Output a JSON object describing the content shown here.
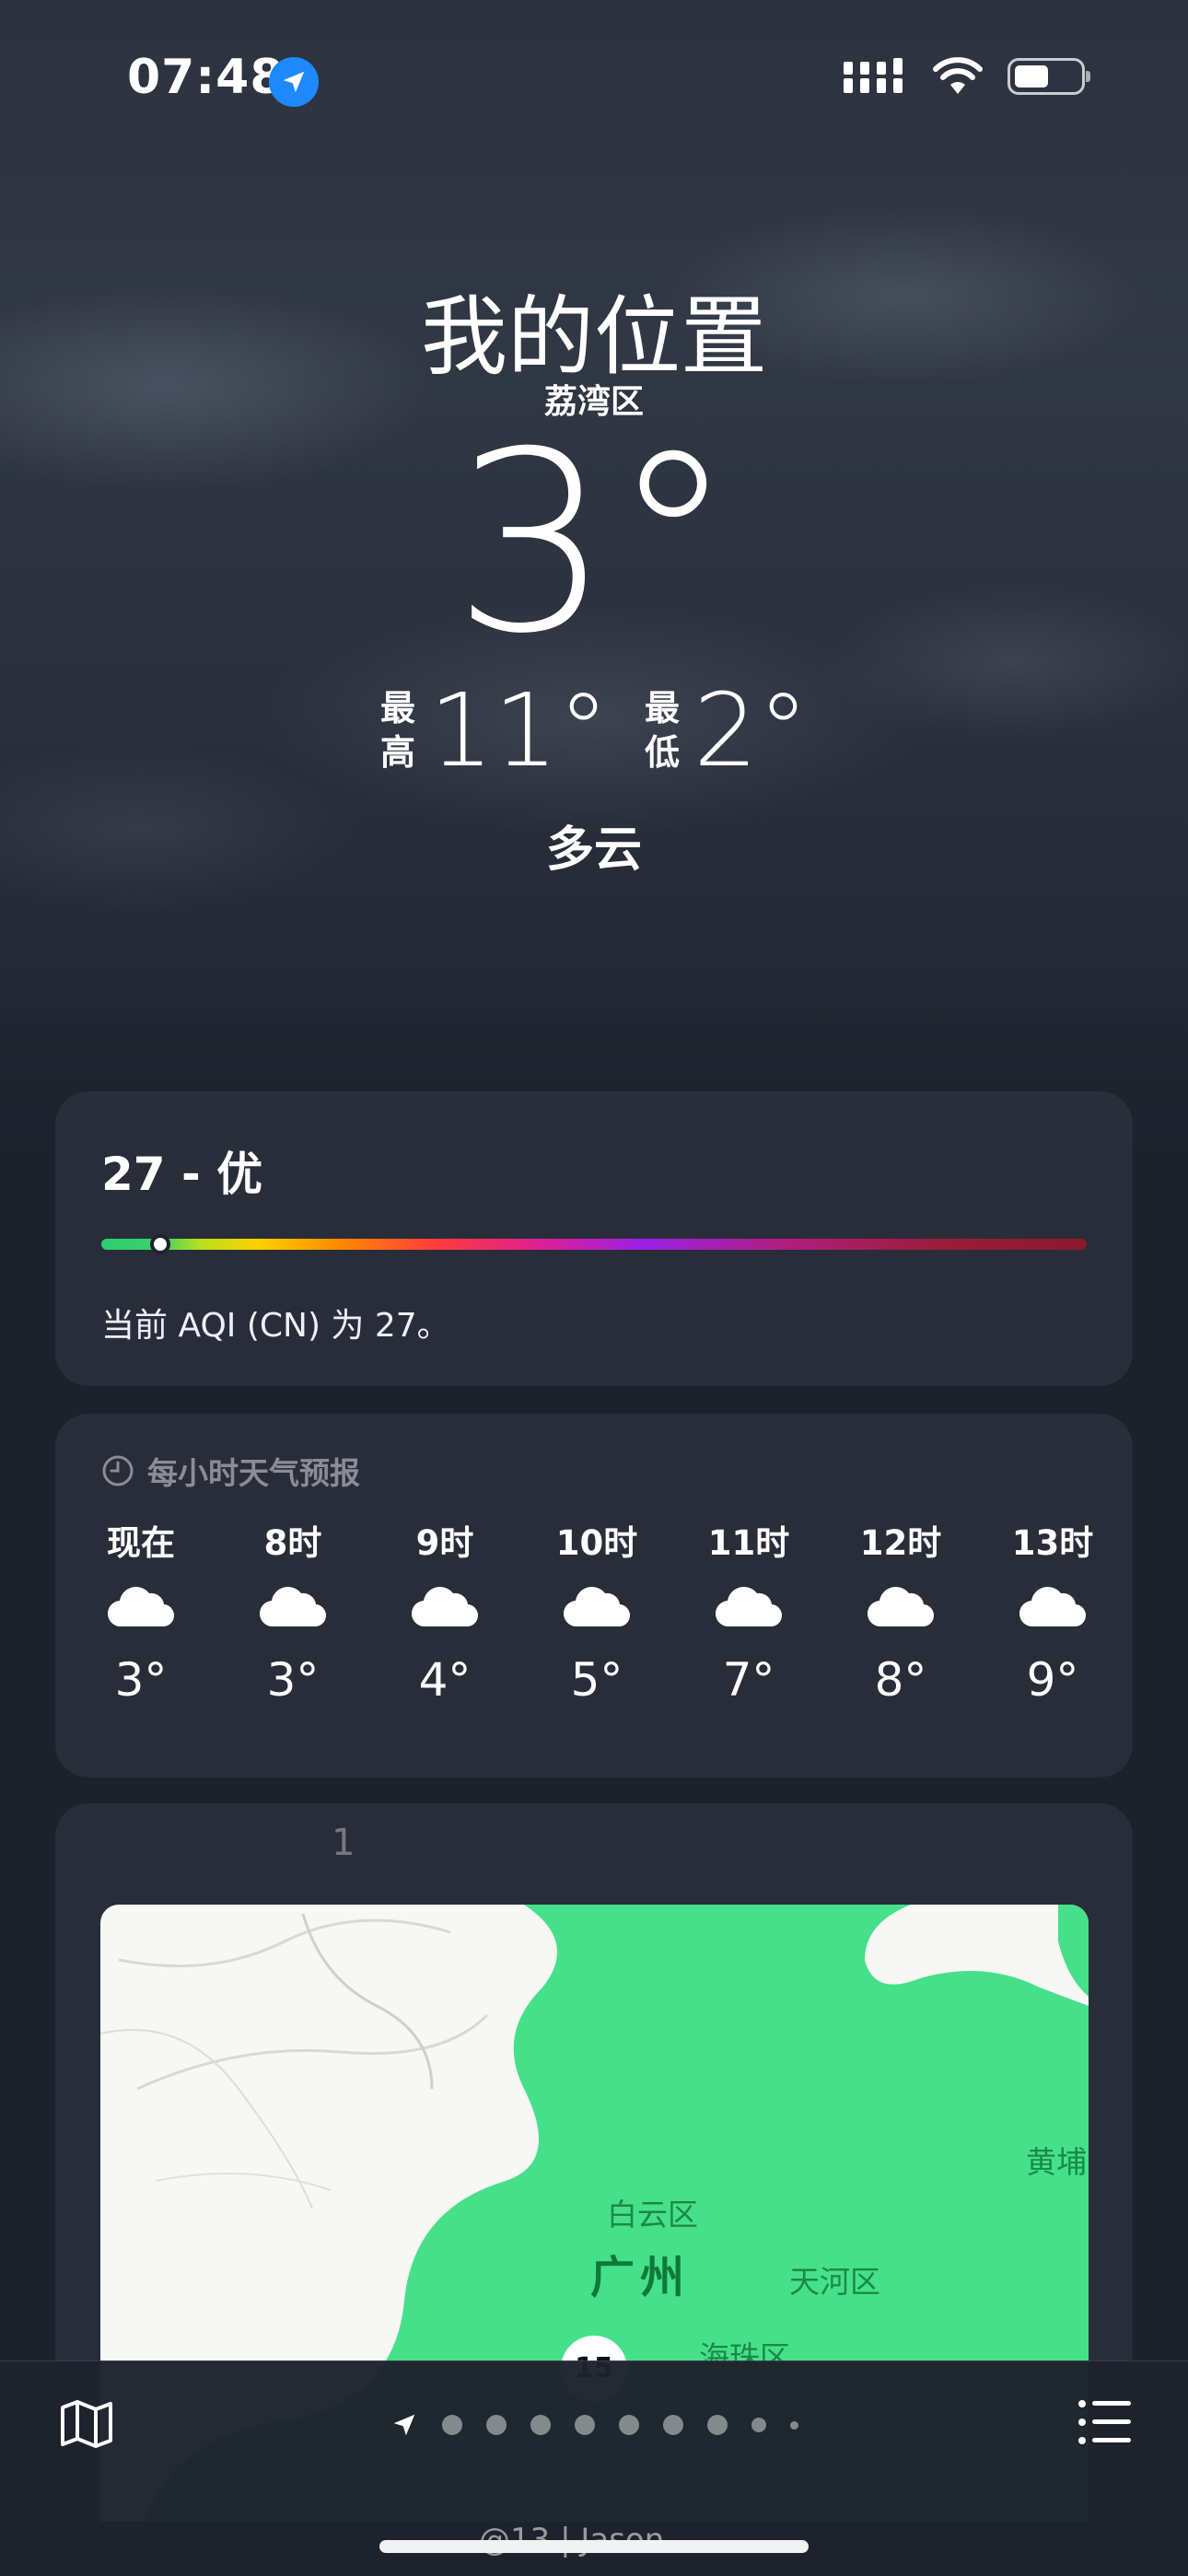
{
  "status_bar": {
    "time": "07:48"
  },
  "header": {
    "title": "我的位置",
    "district": "荔湾区",
    "temperature": "3°",
    "high_label": "最高",
    "high": "11°",
    "low_label": "最低",
    "low": "2°",
    "condition": "多云"
  },
  "aqi": {
    "value_text": "27 - 优",
    "level_fraction": 0.06,
    "description": "当前 AQI (CN) 为 27。",
    "colors": [
      "#2ecc71",
      "#ffd000",
      "#ff3b3b",
      "#9b20e6",
      "#8a1a2a"
    ]
  },
  "hourly": {
    "title": "每小时天气预报",
    "icon": "clock-icon",
    "hours": [
      {
        "label": "现在",
        "icon": "cloud-icon",
        "temp": "3°"
      },
      {
        "label": "8时",
        "icon": "cloud-icon",
        "temp": "3°"
      },
      {
        "label": "9时",
        "icon": "cloud-icon",
        "temp": "4°"
      },
      {
        "label": "10时",
        "icon": "cloud-icon",
        "temp": "5°"
      },
      {
        "label": "11时",
        "icon": "cloud-icon",
        "temp": "7°"
      },
      {
        "label": "12时",
        "icon": "cloud-icon",
        "temp": "8°"
      },
      {
        "label": "13时",
        "icon": "cloud-icon",
        "temp": "9°"
      }
    ]
  },
  "map": {
    "header": "1",
    "labels": [
      "白云区",
      "广州",
      "天河区",
      "黄埔",
      "海珠区"
    ],
    "pin_value": "15",
    "overlay_color": "#46e08b"
  },
  "toolbar": {
    "page_count": 9,
    "current_page_icon": "location-arrow-icon"
  },
  "watermark": "@13 | Jason"
}
